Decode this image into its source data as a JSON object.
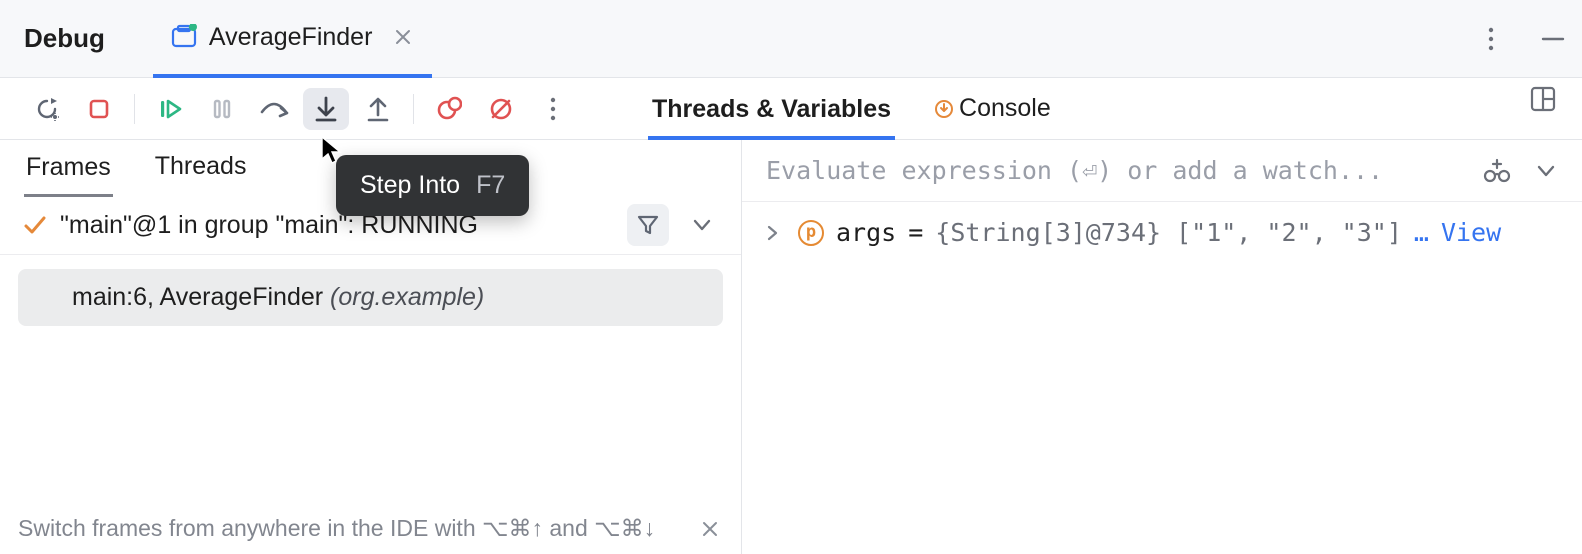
{
  "header": {
    "title": "Debug",
    "run_config": "AverageFinder"
  },
  "tooltip": {
    "label": "Step Into",
    "shortcut": "F7"
  },
  "right_tabs": {
    "threads_vars": "Threads & Variables",
    "console": "Console"
  },
  "left_tabs": {
    "frames": "Frames",
    "threads": "Threads"
  },
  "thread": {
    "text": "\"main\"@1 in group \"main\": RUNNING"
  },
  "frame": {
    "location": "main:6, AverageFinder ",
    "package": "(org.example)"
  },
  "tip": {
    "text": "Switch frames from anywhere in the IDE with ⌥⌘↑ and ⌥⌘↓"
  },
  "eval": {
    "placeholder": "Evaluate expression (⏎) or add a watch..."
  },
  "variable": {
    "name": "args",
    "eq": " = ",
    "value": "{String[3]@734} [\"1\", \"2\", \"3\"]",
    "dots": " … ",
    "view": "View"
  }
}
